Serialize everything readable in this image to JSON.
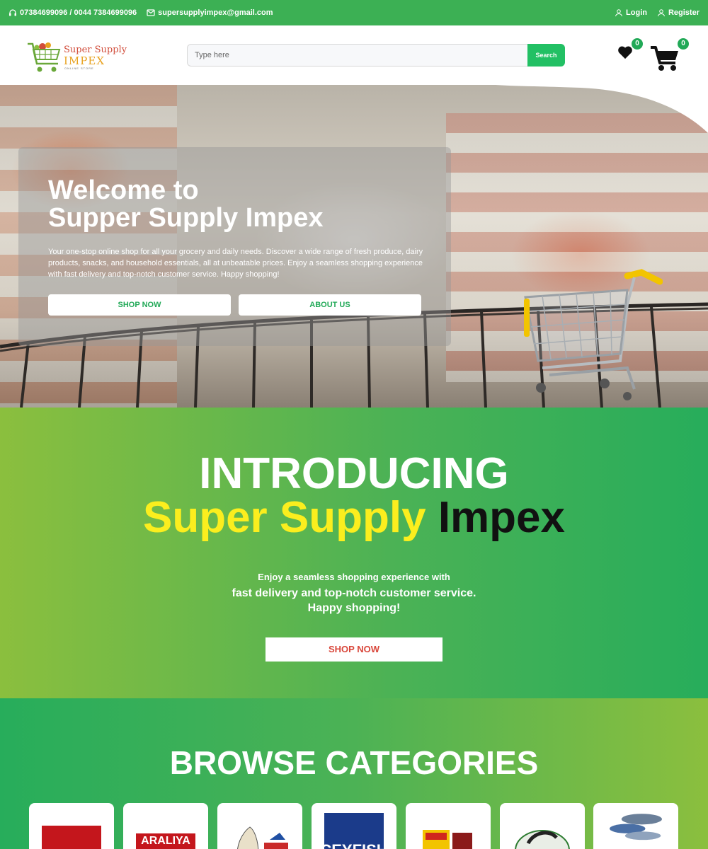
{
  "topbar": {
    "phone": "07384699096 / 0044 7384699096",
    "email": "supersupplyimpex@gmail.com",
    "login": "Login",
    "register": "Register"
  },
  "header": {
    "logo": {
      "line1": "Super Supply",
      "line2": "IMPEX",
      "line3": "ONLINE STORE"
    },
    "search_placeholder": "Type here",
    "search_button": "Search",
    "wishlist_count": "0",
    "cart_count": "0"
  },
  "hero": {
    "title": "Welcome to\nSupper Supply Impex",
    "text": "Your one-stop online shop for all your grocery and daily needs. Discover a wide range of fresh produce, dairy products, snacks, and household essentials, all at unbeatable prices. Enjoy a seamless shopping experience with fast delivery and top-notch customer service. Happy shopping!",
    "shop_now": "SHOP NOW",
    "about_us": "ABOUT US"
  },
  "intro": {
    "line1": "INTRODUCING",
    "brand_yellow": "Super Supply",
    "brand_dark": "Impex",
    "p1": "Enjoy a seamless shopping experience with",
    "p2": "fast delivery and top-notch customer service.",
    "p3": "Happy shopping!",
    "button": "SHOP NOW"
  },
  "categories": {
    "title": "BROWSE CATEGORIES",
    "items": [
      {
        "label": "",
        "color": "#c4161c"
      },
      {
        "label": "ARALIYA",
        "color": "#c4161c"
      },
      {
        "label": "",
        "color": "#c92a2a"
      },
      {
        "label": "CEYFISH",
        "color": "#1b3b8a"
      },
      {
        "label": "",
        "color": "#f2c400"
      },
      {
        "label": "",
        "color": "#2e7d32"
      },
      {
        "label": "",
        "color": "#4a6fa5"
      }
    ]
  },
  "colors": {
    "topbar": "#3cb054",
    "search_button": "#22c064",
    "badge": "#21a957",
    "intro_yellow": "#fbee1e",
    "intro_button_text": "#d9473b"
  }
}
